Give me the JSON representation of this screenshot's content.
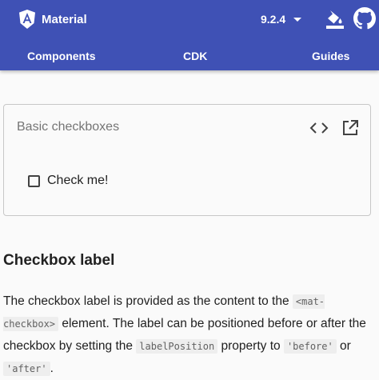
{
  "toolbar": {
    "brand_name": "Material",
    "version": "9.2.4",
    "nav": {
      "components": "Components",
      "cdk": "CDK",
      "guides": "Guides"
    },
    "icons": {
      "logo": "angular-logo-icon",
      "caret": "caret-down-icon",
      "theme": "format-color-fill-icon",
      "github": "github-icon"
    },
    "colors": {
      "primary": "#3f51b5"
    }
  },
  "example": {
    "title": "Basic checkboxes",
    "icons": {
      "code": "code-icon",
      "open": "open-in-new-icon"
    },
    "checkbox": {
      "label": "Check me!",
      "checked": false
    }
  },
  "content": {
    "heading": "Checkbox label",
    "paragraph": {
      "text_1": "The checkbox label is provided as the content to the ",
      "code_1": "<mat-checkbox>",
      "text_2": " element. The label can be positioned before or after the checkbox by setting the ",
      "code_2": "labelPosition",
      "text_3": " property to ",
      "code_3": "'before'",
      "text_4": " or ",
      "code_4": "'after'",
      "text_5": "."
    }
  }
}
